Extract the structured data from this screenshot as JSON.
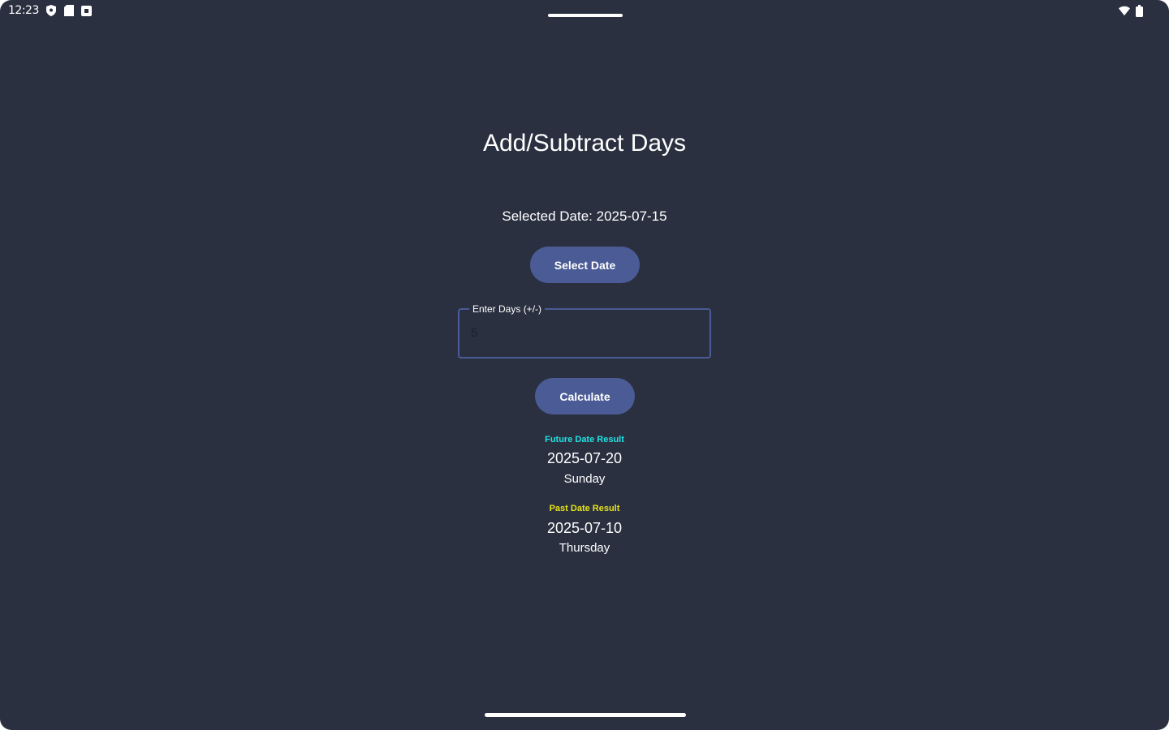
{
  "status_bar": {
    "time": "12:23",
    "left_icons": [
      "shield-icon",
      "sd-card-icon",
      "screenshot-icon"
    ],
    "right_icons": [
      "wifi-icon",
      "battery-icon"
    ]
  },
  "app": {
    "title": "Add/Subtract Days",
    "selected_date_text": "Selected Date: 2025-07-15",
    "select_date_button": "Select Date",
    "days_field": {
      "label": "Enter Days (+/-)",
      "value": "5",
      "placeholder": ""
    },
    "calculate_button": "Calculate",
    "future": {
      "label": "Future Date Result",
      "date": "2025-07-20",
      "weekday": "Sunday"
    },
    "past": {
      "label": "Past Date Result",
      "date": "2025-07-10",
      "weekday": "Thursday"
    }
  },
  "colors": {
    "background": "#2a3040",
    "button": "#4a5b95",
    "future_accent": "#1fe3e3",
    "past_accent": "#e6e21a"
  }
}
